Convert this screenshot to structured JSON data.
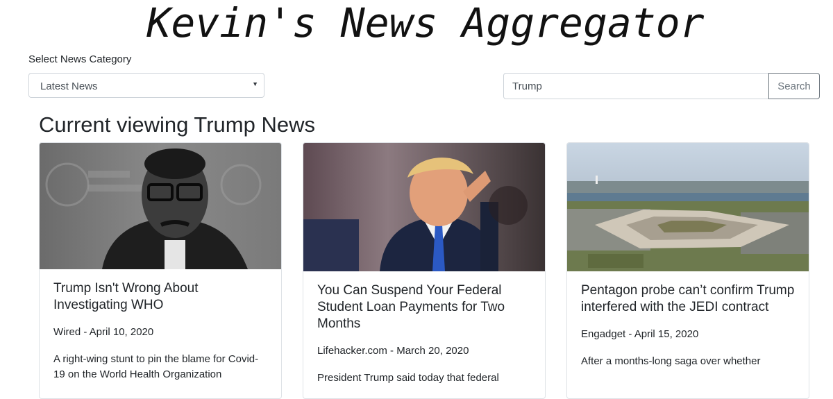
{
  "header": {
    "title": "Kevin's News Aggregator"
  },
  "category": {
    "label": "Select News Category",
    "selected": "Latest News"
  },
  "search": {
    "value": "Trump",
    "button_label": "Search"
  },
  "main": {
    "heading": "Current viewing Trump News",
    "articles": [
      {
        "title": "Trump Isn't Wrong About Investigating WHO",
        "source": "Wired",
        "date": "April 10, 2020",
        "meta": "Wired - April 10, 2020",
        "excerpt": "A right-wing stunt to pin the blame for Covid-19 on the World Health Organization"
      },
      {
        "title": "You Can Suspend Your Federal Student Loan Payments for Two Months",
        "source": "Lifehacker.com",
        "date": "March 20, 2020",
        "meta": "Lifehacker.com - March 20, 2020",
        "excerpt": "President Trump said today that federal"
      },
      {
        "title": "Pentagon probe can’t confirm Trump interfered with the JEDI contract",
        "source": "Engadget",
        "date": "April 15, 2020",
        "meta": "Engadget - April 15, 2020",
        "excerpt": "After a months-long saga over whether"
      }
    ]
  }
}
